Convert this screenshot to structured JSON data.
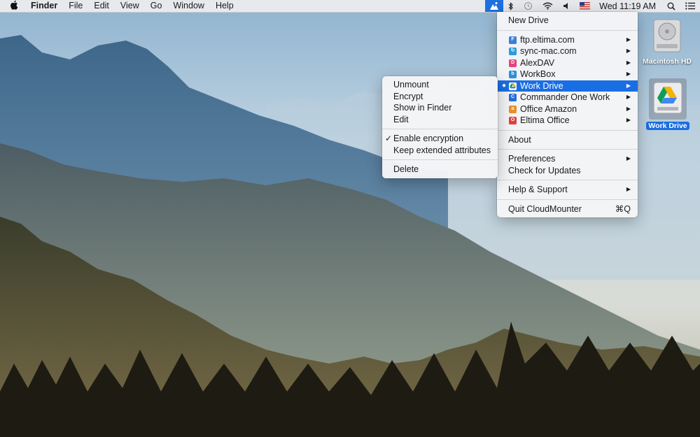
{
  "menubar": {
    "apple_icon": "apple-icon",
    "items": [
      "Finder",
      "File",
      "Edit",
      "View",
      "Go",
      "Window",
      "Help"
    ],
    "status_icons": [
      "cloudmounter-icon",
      "bluetooth-icon",
      "time-machine-icon",
      "wifi-icon",
      "volume-icon",
      "us-flag-icon"
    ],
    "clock": "Wed 11:19 AM",
    "spotlight_icon": "search-icon",
    "notification_icon": "list-icon"
  },
  "main_menu": {
    "new_drive": "New Drive",
    "drives": [
      {
        "label": "ftp.eltima.com",
        "icon": "ftp-icon",
        "color": "#3b7fd6"
      },
      {
        "label": "sync-mac.com",
        "icon": "sync-icon",
        "color": "#2a9be0"
      },
      {
        "label": "AlexDAV",
        "icon": "webdav-icon",
        "color": "#e0457a"
      },
      {
        "label": "WorkBox",
        "icon": "box-icon",
        "color": "#2a8fde"
      },
      {
        "label": "Work Drive",
        "icon": "google-drive-icon",
        "color": "#ffffff"
      },
      {
        "label": "Commander One Work",
        "icon": "commander-one-icon",
        "color": "#2a6bd6"
      },
      {
        "label": "Office Amazon",
        "icon": "amazon-s3-icon",
        "color": "#e8902a"
      },
      {
        "label": "Eltima Office",
        "icon": "office-icon",
        "color": "#e04040"
      }
    ],
    "about": "About",
    "preferences": "Preferences",
    "check_updates": "Check for Updates",
    "help_support": "Help & Support",
    "quit": "Quit CloudMounter",
    "quit_shortcut": "⌘Q"
  },
  "sub_menu": {
    "unmount": "Unmount",
    "encrypt": "Encrypt",
    "show_in_finder": "Show in Finder",
    "edit": "Edit",
    "enable_encryption": "Enable encryption",
    "keep_extended": "Keep extended attributes",
    "delete": "Delete"
  },
  "desktop": {
    "macintosh_hd": "Macintosh HD",
    "work_drive": "Work Drive"
  },
  "colors": {
    "selection": "#1a6ee3",
    "menubar_bg": "#ececee"
  }
}
